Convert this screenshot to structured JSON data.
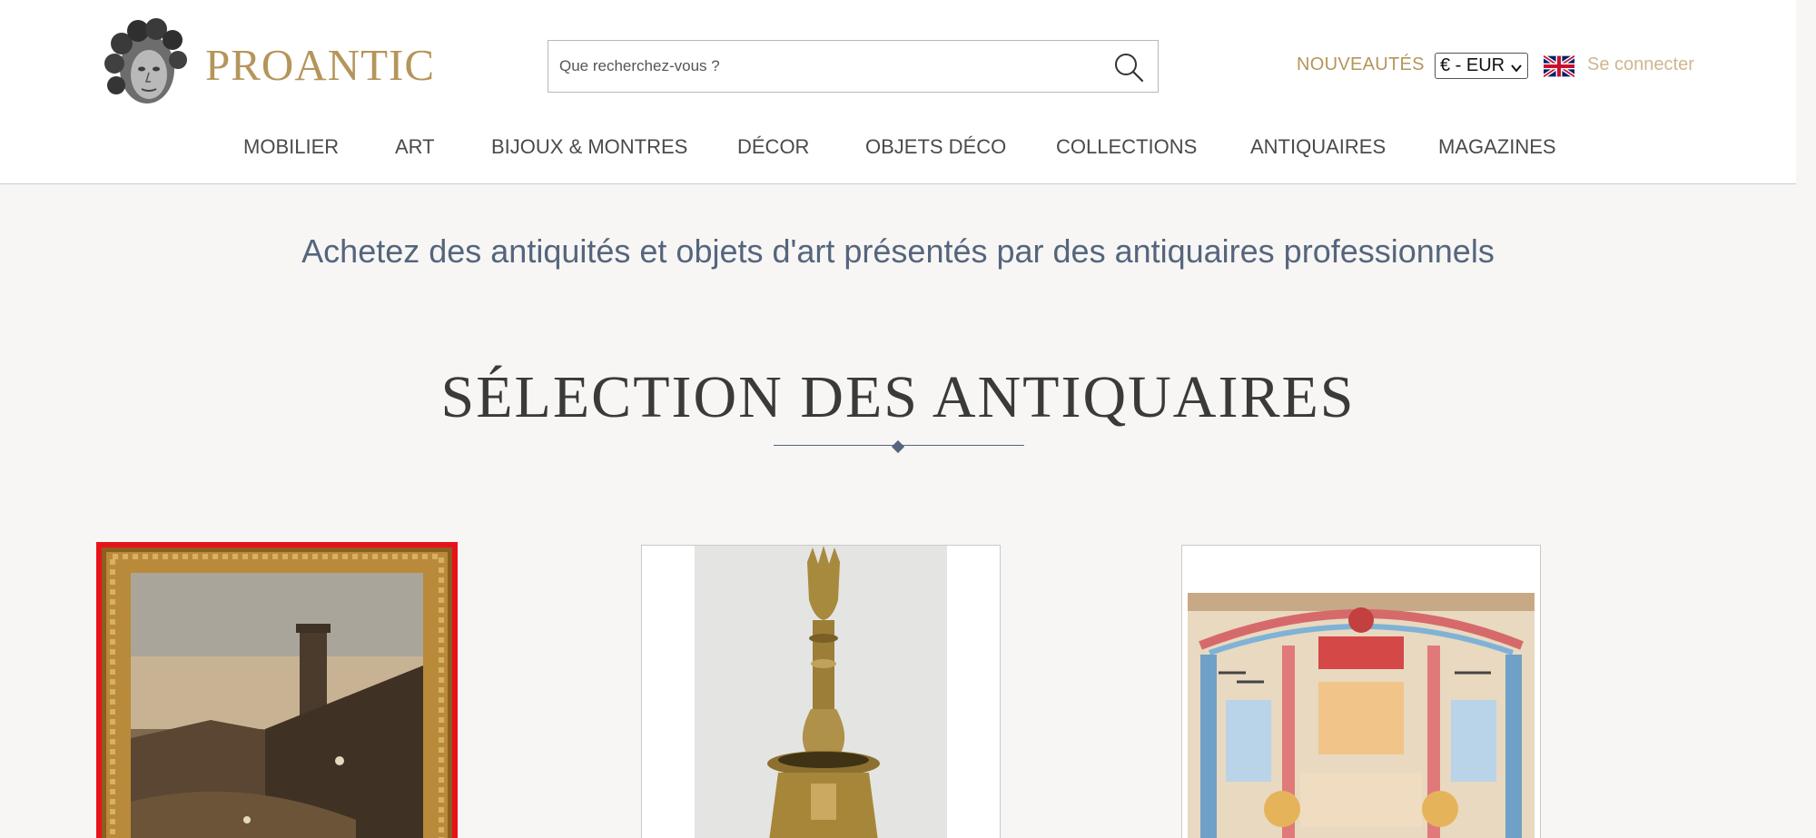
{
  "brand": {
    "name": "PROANTIC"
  },
  "search": {
    "placeholder": "Que recherchez-vous ?"
  },
  "topbar": {
    "nouveautes_label": "NOUVEAUTÉS",
    "currency_value": "€ - EUR",
    "login_label": "Se connecter"
  },
  "nav": {
    "items": [
      "MOBILIER",
      "ART",
      "BIJOUX & MONTRES",
      "DÉCOR",
      "OBJETS DÉCO",
      "COLLECTIONS",
      "ANTIQUAIRES",
      "MAGAZINES"
    ]
  },
  "main": {
    "tagline": "Achetez des antiquités et objets d'art présentés par des antiquaires professionnels",
    "section_title": "SÉLECTION DES ANTIQUAIRES"
  },
  "cards": [
    {
      "image": "framed-painting-coastal-scene",
      "selected": true
    },
    {
      "image": "brass-candlestick",
      "selected": false
    },
    {
      "image": "embroidered-tapestry",
      "selected": false
    }
  ],
  "colors": {
    "gold": "#b5955a",
    "link_light": "#cdb88e",
    "tagline": "#55657d",
    "selection_border": "#e8121b",
    "background": "#f7f6f4"
  }
}
